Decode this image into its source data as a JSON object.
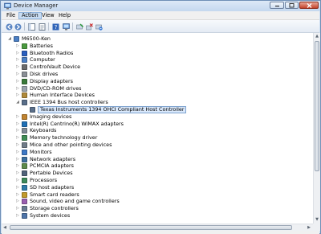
{
  "window": {
    "title": "Device Manager"
  },
  "menu": [
    "File",
    "Action",
    "View",
    "Help"
  ],
  "menu_active_index": 1,
  "toolbar": {
    "icons": [
      "back-icon",
      "forward-icon",
      "show-hide-tree-icon",
      "properties-icon",
      "help-icon",
      "computer-icon",
      "update-driver-icon",
      "disable-device-icon",
      "uninstall-icon",
      "scan-hardware-icon"
    ]
  },
  "tree": {
    "root": "M6500-Ken",
    "items": [
      {
        "label": "Batteries",
        "icon": "battery-icon",
        "expanded": false
      },
      {
        "label": "Bluetooth Radios",
        "icon": "bluetooth-icon",
        "expanded": false
      },
      {
        "label": "Computer",
        "icon": "computer-icon",
        "expanded": false
      },
      {
        "label": "ControlVault Device",
        "icon": "controlvault-icon",
        "expanded": false
      },
      {
        "label": "Disk drives",
        "icon": "disk-drive-icon",
        "expanded": false
      },
      {
        "label": "Display adapters",
        "icon": "display-adapter-icon",
        "expanded": false
      },
      {
        "label": "DVD/CD-ROM drives",
        "icon": "dvd-drive-icon",
        "expanded": false
      },
      {
        "label": "Human Interface Devices",
        "icon": "hid-icon",
        "expanded": false
      },
      {
        "label": "IEEE 1394 Bus host controllers",
        "icon": "ieee1394-icon",
        "expanded": true,
        "children": [
          {
            "label": "Texas Instruments 1394 OHCI Compliant Host Controller",
            "icon": "ieee1394-icon",
            "selected": true
          }
        ]
      },
      {
        "label": "Imaging devices",
        "icon": "imaging-icon",
        "expanded": false
      },
      {
        "label": "Intel(R) Centrino(R) WiMAX adapters",
        "icon": "wimax-icon",
        "expanded": false
      },
      {
        "label": "Keyboards",
        "icon": "keyboard-icon",
        "expanded": false
      },
      {
        "label": "Memory technology driver",
        "icon": "memory-icon",
        "expanded": false
      },
      {
        "label": "Mice and other pointing devices",
        "icon": "mouse-icon",
        "expanded": false
      },
      {
        "label": "Monitors",
        "icon": "monitor-icon",
        "expanded": false
      },
      {
        "label": "Network adapters",
        "icon": "network-adapter-icon",
        "expanded": false
      },
      {
        "label": "PCMCIA adapters",
        "icon": "pcmcia-icon",
        "expanded": false
      },
      {
        "label": "Portable Devices",
        "icon": "portable-device-icon",
        "expanded": false
      },
      {
        "label": "Processors",
        "icon": "processor-icon",
        "expanded": false
      },
      {
        "label": "SD host adapters",
        "icon": "sd-adapter-icon",
        "expanded": false
      },
      {
        "label": "Smart card readers",
        "icon": "smart-card-icon",
        "expanded": false
      },
      {
        "label": "Sound, video and game controllers",
        "icon": "sound-icon",
        "expanded": false
      },
      {
        "label": "Storage controllers",
        "icon": "storage-icon",
        "expanded": false
      },
      {
        "label": "System devices",
        "icon": "system-device-icon",
        "expanded": false
      }
    ]
  },
  "colors": {
    "selection_bg": "#d9e8fb",
    "selection_border": "#7da2ce",
    "close_button": "#c5432a",
    "title_bar": "#cfe0f3"
  }
}
